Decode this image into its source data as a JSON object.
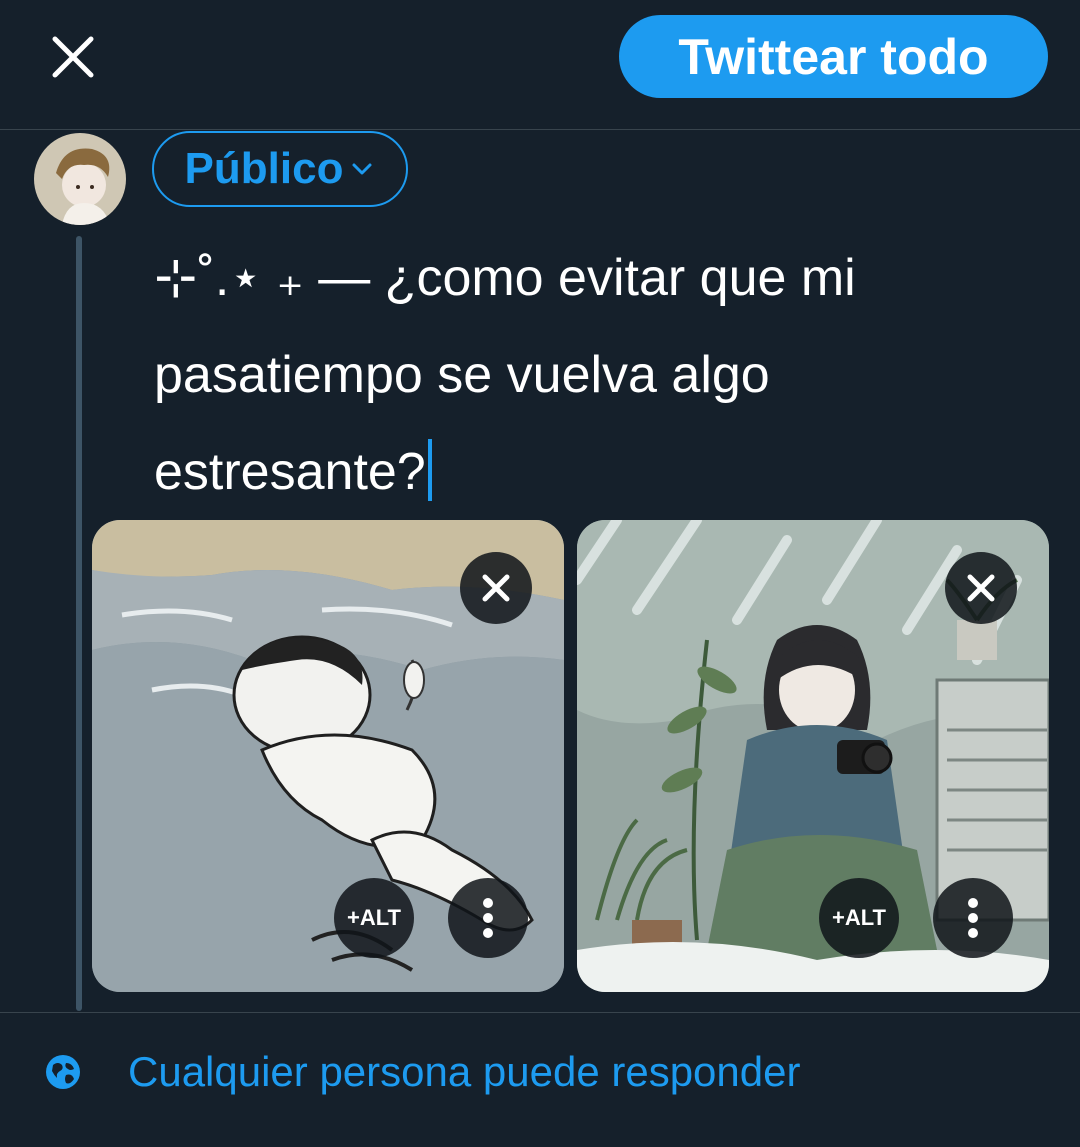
{
  "header": {
    "close_icon": "close-icon",
    "tweet_all_label": "Twittear todo"
  },
  "composer": {
    "avatar_icon": "user-avatar",
    "audience_label": "Público",
    "text": "⊹˚.⋆ ₊ — ¿como evitar que mi\npasatiempo se vuelva algo\nestresante?"
  },
  "media": [
    {
      "alt_label": "+ALT",
      "remove_icon": "close-icon",
      "more_icon": "more-vertical-icon"
    },
    {
      "alt_label": "+ALT",
      "remove_icon": "close-icon",
      "more_icon": "more-vertical-icon"
    }
  ],
  "footer": {
    "reply_icon": "globe-icon",
    "reply_setting_label": "Cualquier persona puede responder"
  },
  "colors": {
    "background": "#15202b",
    "accent": "#1d9bf0",
    "divider": "#38444d",
    "thread_line": "#3d5466"
  }
}
